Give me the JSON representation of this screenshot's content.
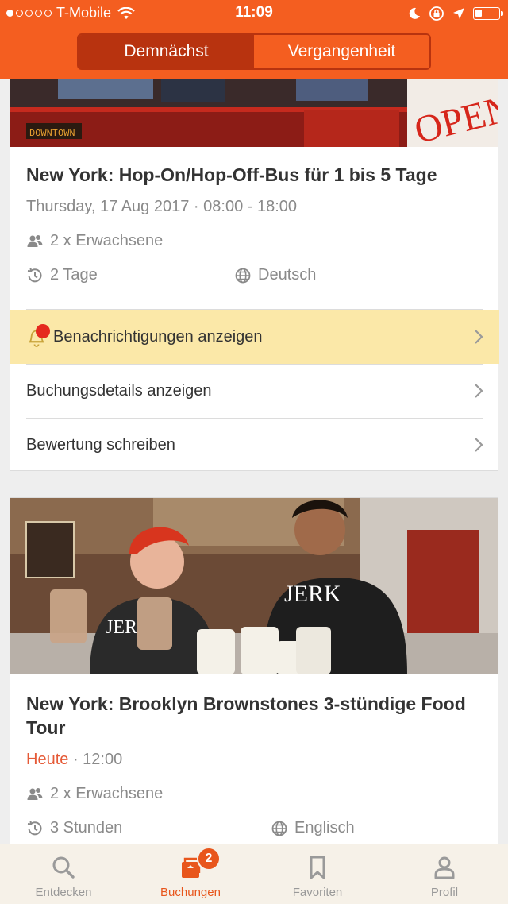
{
  "status_bar": {
    "carrier": "T-Mobile",
    "time": "11:09",
    "signal_bars": 1
  },
  "segments": {
    "upcoming": "Demnächst",
    "past": "Vergangenheit",
    "selected": "upcoming"
  },
  "bookings": [
    {
      "title": "New York: Hop-On/Hop-Off-Bus für 1 bis 5 Tage",
      "date": "Thursday, 17 Aug 2017",
      "separator": "·",
      "time": "08:00 - 18:00",
      "participants": "2 x Erwachsene",
      "duration": "2 Tage",
      "language": "Deutsch",
      "actions": {
        "notifications": "Benachrichtigungen anzeigen",
        "details": "Buchungsdetails anzeigen",
        "review": "Bewertung schreiben"
      }
    },
    {
      "title": "New York: Brooklyn Brownstones 3-stündige Food Tour",
      "date": "Heute",
      "separator": "·",
      "time": "12:00",
      "participants": "2 x Erwachsene",
      "duration": "3 Stunden",
      "language": "Englisch"
    }
  ],
  "tabbar": {
    "discover": "Entdecken",
    "bookings": "Buchungen",
    "favorites": "Favoriten",
    "profile": "Profil",
    "bookings_badge": "2",
    "active": "bookings"
  },
  "colors": {
    "brand": "#f45e20",
    "segment_active": "#b8330f",
    "notification_bg": "#fbe8a8",
    "badge": "#e8561c",
    "today": "#e55a37"
  }
}
